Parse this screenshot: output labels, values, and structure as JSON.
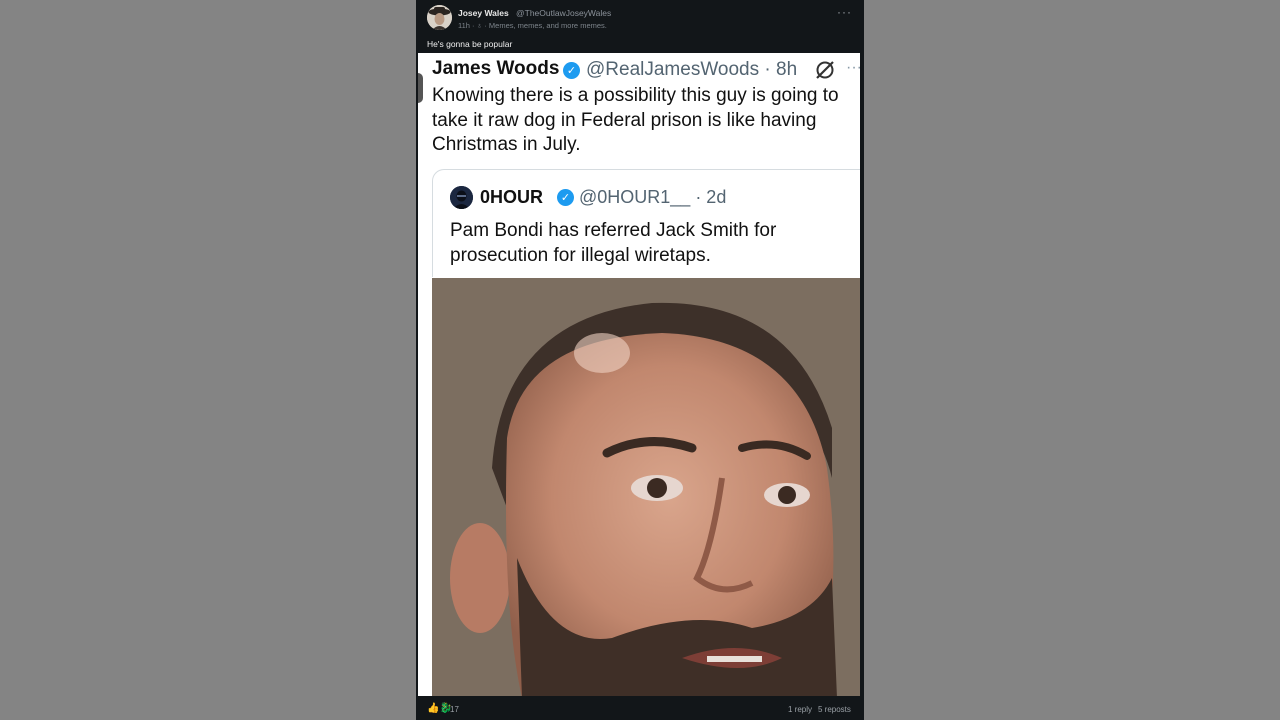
{
  "post": {
    "author_name": "Josey Wales",
    "author_handle": "@TheOutlawJoseyWales",
    "meta": "11h · ♁ · Memes, memes, and more memes.",
    "more_label": "···",
    "caption": "He's gonna be popular",
    "reaction_icons": "👍🐉",
    "reaction_count": "17",
    "replies": "1 reply",
    "reposts": "5 reposts"
  },
  "tweet": {
    "name": "James Woods",
    "handle": "@RealJamesWoods · 8h",
    "more_label": "···",
    "text": "Knowing there is a possibility this guy is going to take it raw dog in Federal prison is like having Christmas in July."
  },
  "quoted": {
    "name": "0HOUR",
    "handle": "@0HOUR1__ · 2d",
    "text": "Pam Bondi has referred Jack Smith for prosecution for illegal wiretaps."
  },
  "icons": {
    "verified": "✓",
    "grok": "grok-icon",
    "avatar": "avatar-icon"
  },
  "colors": {
    "background": "#848484",
    "post_background": "#121619",
    "verified_blue": "#1d9bf0"
  }
}
